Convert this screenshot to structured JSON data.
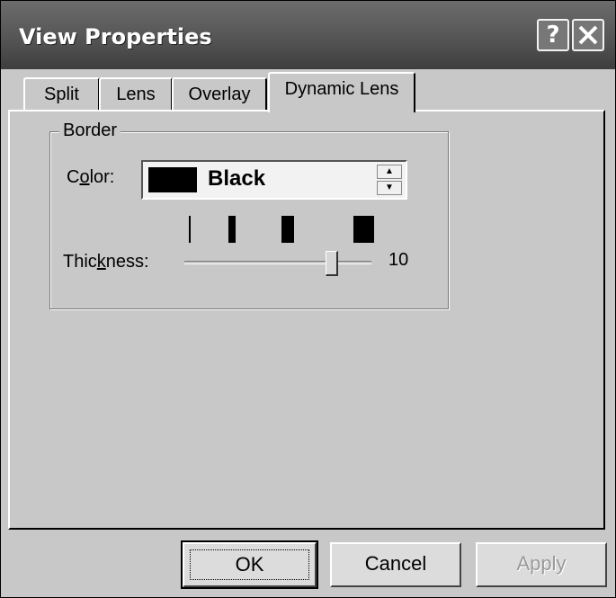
{
  "window": {
    "title": "View Properties",
    "help_glyph": "?",
    "close_icon": "close-icon"
  },
  "tabs": [
    {
      "label": "Split",
      "active": false
    },
    {
      "label": "Lens",
      "active": false
    },
    {
      "label": "Overlay",
      "active": false
    },
    {
      "label": "Dynamic Lens",
      "active": true
    }
  ],
  "border_group": {
    "label": "Border",
    "color": {
      "label_pre": "C",
      "label_mnemonic": "o",
      "label_post": "lor:",
      "value": "Black",
      "swatch_color": "#000000"
    },
    "thickness": {
      "label_pre": "Thic",
      "label_mnemonic": "k",
      "label_post": "ness:",
      "value": "10"
    }
  },
  "buttons": {
    "ok": "OK",
    "cancel": "Cancel",
    "apply": "Apply"
  }
}
